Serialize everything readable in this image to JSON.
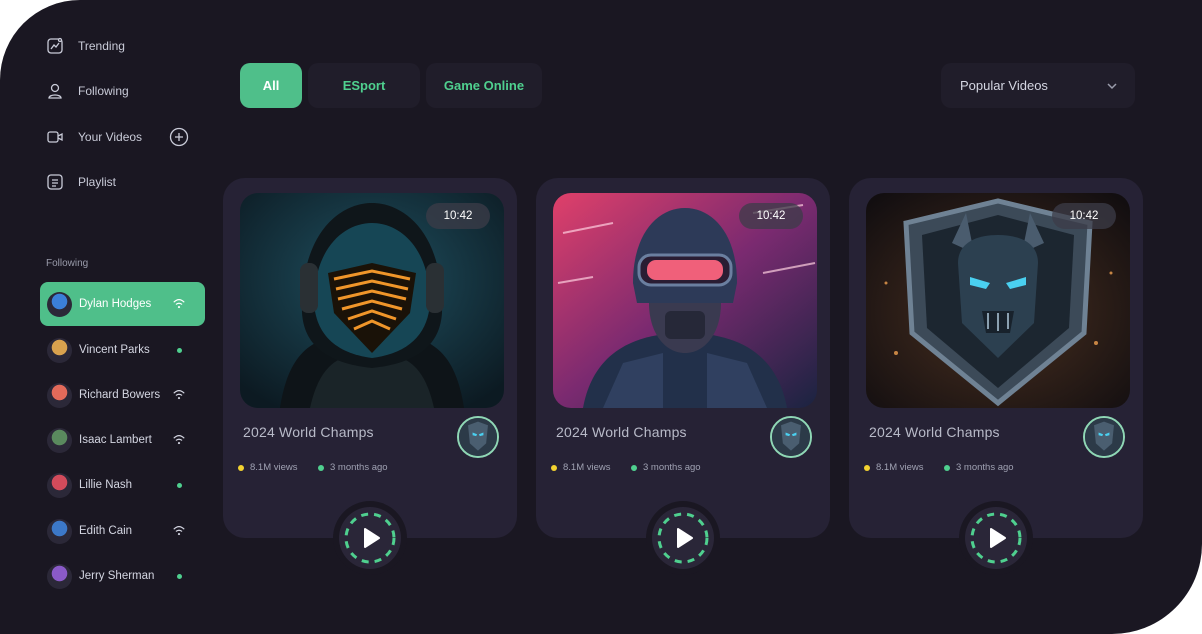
{
  "sidebar": {
    "nav": [
      {
        "label": "Trending",
        "icon": "trending-icon"
      },
      {
        "label": "Following",
        "icon": "user-icon"
      },
      {
        "label": "Your Videos",
        "icon": "video-icon"
      },
      {
        "label": "Playlist",
        "icon": "playlist-icon"
      }
    ],
    "following_section_label": "Following",
    "following": [
      {
        "name": "Dylan Hodges",
        "status": "live",
        "active": true,
        "avatar_color": "#3b7fd9"
      },
      {
        "name": "Vincent Parks",
        "status": "online",
        "active": false,
        "avatar_color": "#d9a24e"
      },
      {
        "name": "Richard Bowers",
        "status": "live",
        "active": false,
        "avatar_color": "#e26a5a"
      },
      {
        "name": "Isaac Lambert",
        "status": "live",
        "active": false,
        "avatar_color": "#5a8a5e"
      },
      {
        "name": "Lillie Nash",
        "status": "online",
        "active": false,
        "avatar_color": "#d24b5b"
      },
      {
        "name": "Edith Cain",
        "status": "live",
        "active": false,
        "avatar_color": "#3c78c8"
      },
      {
        "name": "Jerry Sherman",
        "status": "online",
        "active": false,
        "avatar_color": "#8a5ac8"
      }
    ]
  },
  "tabs": [
    {
      "label": "All",
      "active": true
    },
    {
      "label": "ESport",
      "active": false
    },
    {
      "label": "Game Online",
      "active": false
    }
  ],
  "sort_dropdown": {
    "selected": "Popular Videos",
    "icon": "chevron-down-icon"
  },
  "cards": [
    {
      "title": "2024 World Champs",
      "duration": "10:42",
      "views": "8.1M views",
      "age": "3 months ago",
      "thumb": "hooded-masked-gamer"
    },
    {
      "title": "2024 World Champs",
      "duration": "10:42",
      "views": "8.1M views",
      "age": "3 months ago",
      "thumb": "helmeted-soldier-neon"
    },
    {
      "title": "2024 World Champs",
      "duration": "10:42",
      "views": "8.1M views",
      "age": "3 months ago",
      "thumb": "demon-shield-emblem"
    }
  ],
  "colors": {
    "accent": "#4fbf8a",
    "background": "#1a1722",
    "card": "#262235",
    "views_dot": "#f2d230",
    "age_dot": "#4fd08f"
  }
}
